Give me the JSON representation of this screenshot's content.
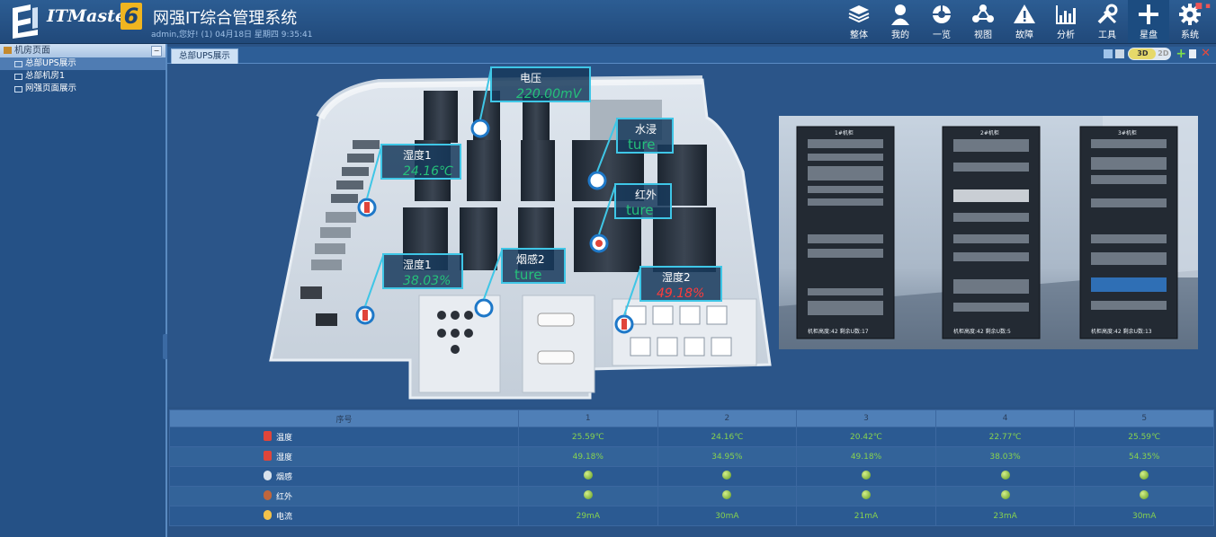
{
  "app": {
    "brand": "ITMaster",
    "brand_version": "6",
    "title": "网强IT综合管理系统",
    "user_line": "admin,您好! (1) 04月18日 星期四 9:35:41"
  },
  "nav": [
    {
      "label": "整体",
      "icon": "layers-icon"
    },
    {
      "label": "我的",
      "icon": "user-icon"
    },
    {
      "label": "一览",
      "icon": "overview-icon"
    },
    {
      "label": "视图",
      "icon": "topology-icon"
    },
    {
      "label": "故障",
      "icon": "alert-icon"
    },
    {
      "label": "分析",
      "icon": "chart-icon"
    },
    {
      "label": "工具",
      "icon": "tools-icon"
    },
    {
      "label": "星盘",
      "icon": "plus-icon"
    },
    {
      "label": "系统",
      "icon": "gear-icon"
    }
  ],
  "sidebar": {
    "title": "机房页面",
    "items": [
      "总部UPS展示",
      "总部机房1",
      "网强页面展示"
    ]
  },
  "tab": {
    "label": "总部UPS展示"
  },
  "view_toggle": {
    "on": "3D",
    "off": "2D"
  },
  "floor_labels": [
    {
      "title": "电压",
      "value": "220.00mV"
    },
    {
      "title": "水浸",
      "value": "ture"
    },
    {
      "title": "湿度1",
      "value": "24.16℃"
    },
    {
      "title": "红外",
      "value": "ture"
    },
    {
      "title": "烟感2",
      "value": "ture"
    },
    {
      "title": "湿度1",
      "value": "38.03%"
    },
    {
      "title": "湿度2",
      "value": "49.18%"
    }
  ],
  "rack_photo": {
    "rack_tags": [
      "1#机柜",
      "2#机柜",
      "3#机柜"
    ],
    "rack_footers": [
      "机柜高度:42  剩余U数:17",
      "机柜高度:42  剩余U数:5",
      "机柜高度:42  剩余U数:13"
    ]
  },
  "table": {
    "header": {
      "label": "序号",
      "cols": [
        "1",
        "2",
        "3",
        "4",
        "5"
      ]
    },
    "rows": [
      {
        "label": "温度",
        "type": "text",
        "values": [
          "25.59℃",
          "24.16℃",
          "20.42℃",
          "22.77℃",
          "25.59℃"
        ]
      },
      {
        "label": "湿度",
        "type": "text",
        "values": [
          "49.18%",
          "34.95%",
          "49.18%",
          "38.03%",
          "54.35%"
        ]
      },
      {
        "label": "烟感",
        "type": "dot",
        "values": [
          "",
          "",
          "",
          "",
          ""
        ]
      },
      {
        "label": "红外",
        "type": "dot",
        "values": [
          "",
          "",
          "",
          "",
          ""
        ]
      },
      {
        "label": "电流",
        "type": "text",
        "values": [
          "29mA",
          "30mA",
          "21mA",
          "23mA",
          "30mA"
        ]
      }
    ]
  }
}
